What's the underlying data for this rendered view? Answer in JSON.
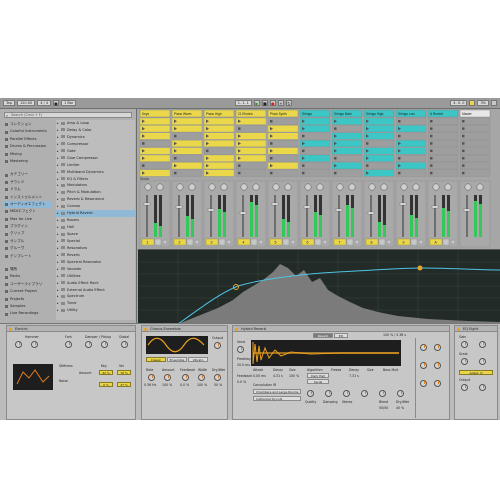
{
  "transport": {
    "bpm": "118",
    "tap": "Tap",
    "sig": "4 / 4",
    "pos": "120.00",
    "bar": "1 Bar",
    "pos2": "1. 1. 1",
    "end": "4. 0. 0",
    "cpu": "3%"
  },
  "browser": {
    "search_placeholder": "Search (Cmd + F)",
    "categories": [
      {
        "label": "コレクション"
      },
      {
        "label": "Colorful Instruments"
      },
      {
        "label": "Parallel Effects"
      },
      {
        "label": "Drums & Percussion"
      },
      {
        "label": "Mixing"
      },
      {
        "label": "Mastering"
      },
      {
        "label": "カテゴリー"
      },
      {
        "label": "サウンド"
      },
      {
        "label": "ドラム"
      },
      {
        "label": "インストゥルメント"
      },
      {
        "label": "オーディオエフェクト"
      },
      {
        "label": "MIDIエフェクト"
      },
      {
        "label": "Max for Live"
      },
      {
        "label": "プラグイン"
      },
      {
        "label": "クリップ"
      },
      {
        "label": "サンプル"
      },
      {
        "label": "グルーヴ"
      },
      {
        "label": "テンプレート"
      },
      {
        "label": "場所"
      },
      {
        "label": "Packs"
      },
      {
        "label": "ユーザーライブラリ"
      },
      {
        "label": "Current Project"
      },
      {
        "label": "Projects"
      },
      {
        "label": "Samples"
      },
      {
        "label": "Live Recordings"
      }
    ],
    "items": [
      {
        "label": "Amp & Loop"
      },
      {
        "label": "Delay & Color"
      },
      {
        "label": "Dynamics"
      },
      {
        "label": "Compressor"
      },
      {
        "label": "Gate"
      },
      {
        "label": "Glue Compressor"
      },
      {
        "label": "Limiter"
      },
      {
        "label": "Multiband Dynamics"
      },
      {
        "label": "EQ & Filters"
      },
      {
        "label": "Modulators"
      },
      {
        "label": "Pitch & Modulation"
      },
      {
        "label": "Reverb & Resonance"
      },
      {
        "label": "Convos"
      },
      {
        "label": "Hybrid Reverb"
      },
      {
        "label": "Rooms"
      },
      {
        "label": "Hall"
      },
      {
        "label": "Space"
      },
      {
        "label": "Special"
      },
      {
        "label": "Resonators"
      },
      {
        "label": "Reverb"
      },
      {
        "label": "Spectral Resonator"
      },
      {
        "label": "Vocoder"
      },
      {
        "label": "Utilities"
      },
      {
        "label": "Audio Effect Rack"
      },
      {
        "label": "External Audio Effect"
      },
      {
        "label": "Spectrum"
      },
      {
        "label": "Tuner"
      },
      {
        "label": "Utility"
      }
    ]
  },
  "tracks": [
    {
      "name": "Keys",
      "color": "#ead84a",
      "num": "1"
    },
    {
      "name": "Piano Warm",
      "color": "#ead84a",
      "num": "2"
    },
    {
      "name": "Piano High",
      "color": "#ead84a",
      "num": "3"
    },
    {
      "name": "21 Electric",
      "color": "#ead84a",
      "num": "4"
    },
    {
      "name": "Pluck Synth",
      "color": "#ead84a",
      "num": "5"
    },
    {
      "name": "Strings",
      "color": "#3cc6c6",
      "num": "6"
    },
    {
      "name": "Strings Main",
      "color": "#3cc6c6",
      "num": "7"
    },
    {
      "name": "Strings High",
      "color": "#3cc6c6",
      "num": "8"
    },
    {
      "name": "Strings Low",
      "color": "#3cc6c6",
      "num": "9"
    },
    {
      "name": "A Reverb",
      "color": "#3cc6c6",
      "num": "A"
    },
    {
      "name": "Master",
      "color": "#e7e7e7",
      "num": ""
    }
  ],
  "mixer": {
    "sends_label": "Sends"
  },
  "devices": {
    "electric": {
      "title": "Electric",
      "hammer": "Hammer",
      "fork": "Fork",
      "damper": "Damper / Pickup",
      "global": "Global",
      "stiffness": "Stiffness",
      "noise": "Noise",
      "amount": "Amount",
      "key": "Key",
      "vel": "Vel",
      "v1": "42 %",
      "v2": "78 %",
      "v3": "0 %",
      "v4": "37 %"
    },
    "chorus": {
      "title": "Chorus-Ensemble",
      "classic": "Classic",
      "ensemble": "Ensemble",
      "vibrato": "Vibrato",
      "output": "Output",
      "rate": "Rate",
      "amount": "Amount",
      "feedback": "Feedback",
      "width": "Width",
      "dry_wet": "Dry/Wet",
      "rate_val": "0.36 Hz",
      "amt_val": "100 %",
      "fb_val": "0.0 %",
      "width_val": "100 %",
      "dw_val": "50 %"
    },
    "hybrid": {
      "title": "Hybrid Reverb",
      "tab_reverb": "Reverb",
      "tab_eq": "EQ",
      "attack": "Attack",
      "decay": "Decay",
      "size": "Size",
      "algorithm": "Algorithm",
      "freeze": "Freeze",
      "decay2": "Decay",
      "size2": "Size",
      "send": "Send",
      "predelay": "Predelay",
      "feedback": "Feedback",
      "damping": "Damping",
      "blend": "Blend",
      "dry_wet": "Dry/Wet",
      "att_val": "0.00 ms",
      "dec_val": "4.31 s",
      "size_val": "100 %",
      "algo_val": "Dark Hall",
      "decay_val": "7.31 s",
      "conv_label": "Convolution IR",
      "ir_cat": "Chambers and Large Rooms",
      "ir_name": "Cathedral Dyn LR",
      "time": "100 %  /  5.38 s",
      "pd_val": "20.0 ms",
      "fb_val": "0.0 %",
      "blend_val": "50/50",
      "dw_val": "40 %",
      "serial": "Serial",
      "quality": "Quality",
      "bass_mult": "Bass Mult",
      "stereo": "Stereo"
    },
    "eq8": {
      "title": "EQ Eight",
      "gain": "Gain",
      "scale": "Scale",
      "adapt": "Adapt. Q",
      "output": "Output"
    }
  },
  "colors": {
    "accent": "#e9d64a",
    "cyan": "#3cc6c6",
    "selection": "#8fb9d6",
    "spectrum": "#8a8a8a",
    "curve": "#4fc3e6",
    "node": "#e4a52f"
  }
}
